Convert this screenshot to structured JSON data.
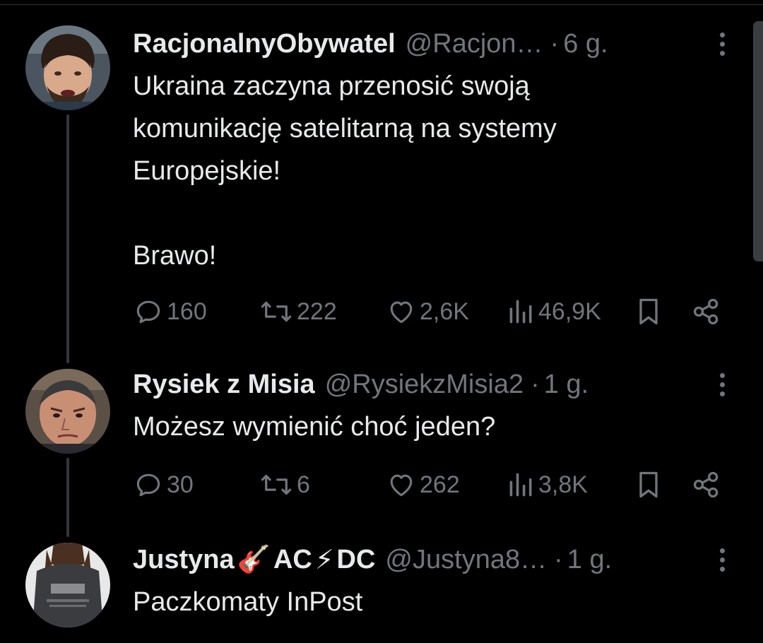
{
  "tweets": [
    {
      "display_name": "RacjonalnyObywatel",
      "handle": "@Racjon…",
      "separator": "·",
      "time": "6 g.",
      "text": "Ukraina zaczyna przenosić swoją\nkomunikację satelitarną na systemy\nEuropejskie!\n\nBrawo!",
      "replies": "160",
      "reposts": "222",
      "likes": "2,6K",
      "views": "46,9K"
    },
    {
      "display_name": "Rysiek z Misia",
      "handle": "@RysiekzMisia2",
      "separator": "·",
      "time": "1 g.",
      "text": "Możesz wymienić choć jeden?",
      "replies": "30",
      "reposts": "6",
      "likes": "262",
      "views": "3,8K"
    },
    {
      "display_name_part1": "Justyna",
      "display_name_part2": "AC",
      "display_name_part3": "DC",
      "emoji_guitar": "🎸",
      "emoji_bolt": "⚡",
      "handle": "@Justyna8…",
      "separator": "·",
      "time": "1 g.",
      "text": "Paczkomaty InPost"
    }
  ],
  "colors": {
    "background": "#000000",
    "text": "#e7e9ea",
    "secondary": "#71767b",
    "thread_line": "#333639"
  },
  "icons": {
    "reply": "reply-icon",
    "repost": "repost-icon",
    "like": "like-icon",
    "views": "views-icon",
    "bookmark": "bookmark-icon",
    "share": "share-icon",
    "more": "more-icon"
  }
}
